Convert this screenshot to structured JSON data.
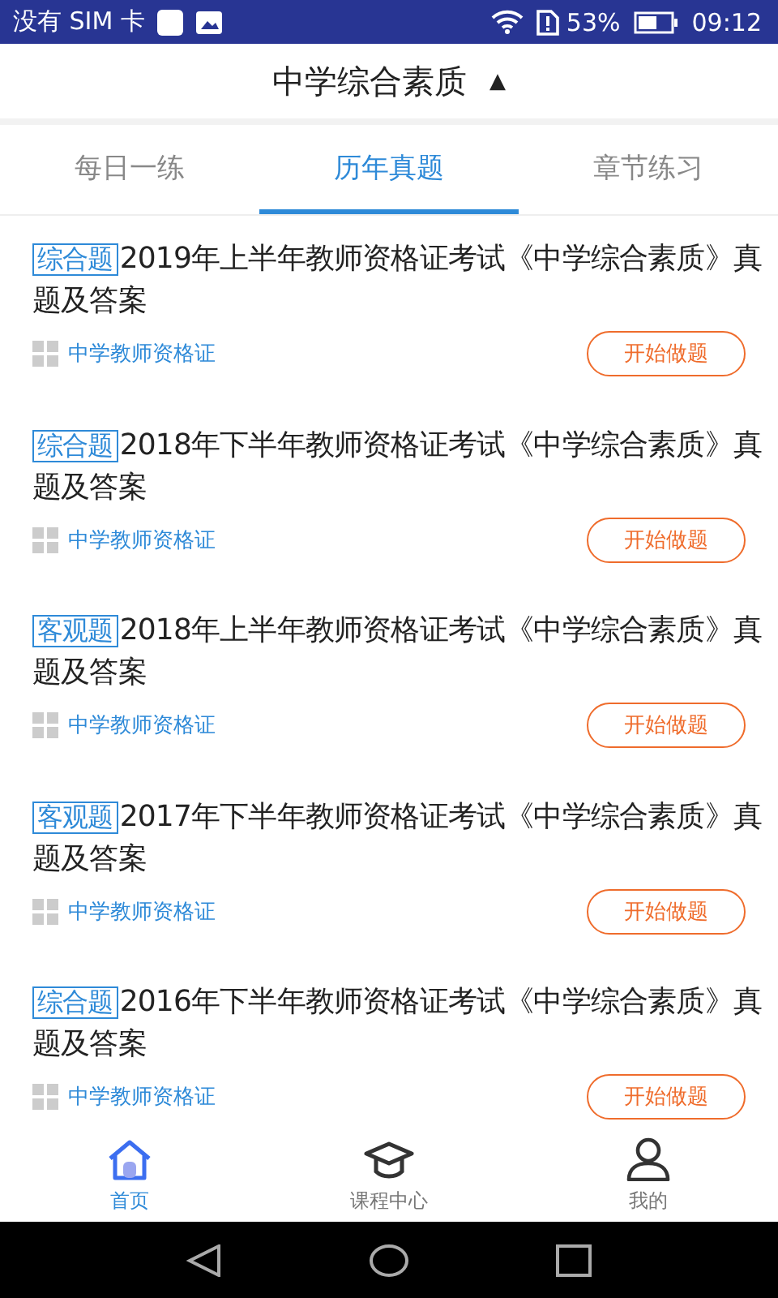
{
  "status_bar": {
    "carrier": "没有 SIM 卡",
    "battery_percent": "53%",
    "time": "09:12"
  },
  "header": {
    "title": "中学综合素质",
    "arrow": "▲"
  },
  "tabs": [
    {
      "label": "每日一练",
      "selected": false
    },
    {
      "label": "历年真题",
      "selected": true
    },
    {
      "label": "章节练习",
      "selected": false
    }
  ],
  "items": [
    {
      "tag": "综合题",
      "title": "2019年上半年教师资格证考试《中学综合素质》真题及答案",
      "category": "中学教师资格证",
      "button": "开始做题"
    },
    {
      "tag": "综合题",
      "title": "2018年下半年教师资格证考试《中学综合素质》真题及答案",
      "category": "中学教师资格证",
      "button": "开始做题"
    },
    {
      "tag": "客观题",
      "title": "2018年上半年教师资格证考试《中学综合素质》真题及答案",
      "category": "中学教师资格证",
      "button": "开始做题"
    },
    {
      "tag": "客观题",
      "title": "2017年下半年教师资格证考试《中学综合素质》真题及答案",
      "category": "中学教师资格证",
      "button": "开始做题"
    },
    {
      "tag": "综合题",
      "title": "2016年下半年教师资格证考试《中学综合素质》真题及答案",
      "category": "中学教师资格证",
      "button": "开始做题"
    }
  ],
  "bottom_nav": [
    {
      "kind": "home",
      "label": "首页",
      "selected": true
    },
    {
      "kind": "course",
      "label": "课程中心",
      "selected": false
    },
    {
      "kind": "profile",
      "label": "我的",
      "selected": false
    }
  ]
}
